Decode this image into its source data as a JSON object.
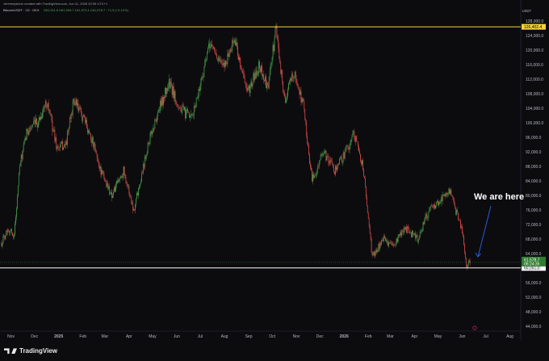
{
  "header": {
    "author_line": "Jeremeystcrio created with TradingView.com, Jun 11, 2026 20:35 UTC+1",
    "symbol": "Bitcoin/USDT · 1D · OKX",
    "ohlc": "O61,911.6 H61,999.7 L61,573.4 C61,578.7 −71.5 (−0.12%)"
  },
  "unit_label": "USDT",
  "annotation": "We are here",
  "footer": {
    "brand": "TradingView"
  },
  "colors": {
    "background": "#0c0c0f",
    "up": "#4caf50",
    "down": "#ef5350",
    "level_line_top": "#f5d33a",
    "level_line_bottom": "#ffffff",
    "arrow": "#2a5bd7"
  },
  "chart_data": {
    "type": "candlestick",
    "title": "Bitcoin/USDT · 1D · OKX",
    "y_unit": "USDT",
    "ylim": [
      42000,
      134000
    ],
    "y_ticks": [
      44000,
      48000,
      52000,
      56000,
      60000,
      64000,
      68000,
      72000,
      76000,
      80000,
      84000,
      88000,
      92000,
      96000,
      100000,
      104000,
      108000,
      112000,
      116000,
      120000,
      124000,
      128000
    ],
    "x_ticks": [
      "Nov",
      "Dec",
      "2025",
      "Feb",
      "Mar",
      "Apr",
      "May",
      "Jun",
      "Jul",
      "Aug",
      "Sep",
      "Oct",
      "Nov",
      "Dec",
      "2026",
      "Feb",
      "Mar",
      "Apr",
      "May",
      "Jun",
      "Jul",
      "Aug"
    ],
    "grid": false,
    "horizontal_levels": [
      {
        "value": 126402.4,
        "label": "126,402.4",
        "color": "#f5d33a"
      },
      {
        "value": 60051.0,
        "label": "60,051.0",
        "color": "#ffffff"
      }
    ],
    "current_price": {
      "value": 61578.7,
      "label": "61,578.7",
      "countdown": "06:24:35"
    },
    "price_path": [
      [
        "Oct 20",
        67000
      ],
      [
        "Oct 28",
        71000
      ],
      [
        "Nov 5",
        69000
      ],
      [
        "Nov 12",
        88000
      ],
      [
        "Nov 22",
        98000
      ],
      [
        "Dec 5",
        100000
      ],
      [
        "Dec 17",
        106000
      ],
      [
        "Dec 30",
        93000
      ],
      [
        "Jan 10",
        94000
      ],
      [
        "Jan 20",
        106000
      ],
      [
        "Jan 31",
        102000
      ],
      [
        "Feb 10",
        97000
      ],
      [
        "Feb 25",
        86000
      ],
      [
        "Mar 10",
        80000
      ],
      [
        "Mar 25",
        87000
      ],
      [
        "Apr 7",
        76000
      ],
      [
        "Apr 25",
        94000
      ],
      [
        "May 10",
        104000
      ],
      [
        "May 22",
        111000
      ],
      [
        "Jun 5",
        104000
      ],
      [
        "Jun 20",
        101000
      ],
      [
        "Jul 14",
        122000
      ],
      [
        "Jul 30",
        115000
      ],
      [
        "Aug 14",
        123000
      ],
      [
        "Aug 30",
        108000
      ],
      [
        "Sep 15",
        116000
      ],
      [
        "Sep 25",
        109000
      ],
      [
        "Oct 6",
        126000
      ],
      [
        "Oct 17",
        106000
      ],
      [
        "Oct 28",
        114000
      ],
      [
        "Nov 10",
        105000
      ],
      [
        "Nov 21",
        84000
      ],
      [
        "Dec 5",
        92000
      ],
      [
        "Dec 20",
        87000
      ],
      [
        "Jan 5",
        93000
      ],
      [
        "Jan 14",
        97000
      ],
      [
        "Jan 25",
        88000
      ],
      [
        "Feb 6",
        63000
      ],
      [
        "Feb 20",
        68000
      ],
      [
        "Mar 5",
        66000
      ],
      [
        "Mar 20",
        71000
      ],
      [
        "Apr 5",
        68000
      ],
      [
        "Apr 20",
        76000
      ],
      [
        "May 5",
        79000
      ],
      [
        "May 15",
        82000
      ],
      [
        "May 25",
        75000
      ],
      [
        "Jun 1",
        70000
      ],
      [
        "Jun 6",
        60500
      ],
      [
        "Jun 11",
        61578.7
      ]
    ]
  }
}
